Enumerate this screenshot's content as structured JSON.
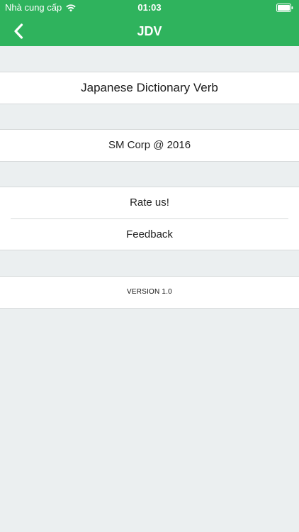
{
  "status_bar": {
    "carrier": "Nhà cung cấp",
    "time": "01:03",
    "icons": [
      "wifi-icon",
      "battery-icon"
    ]
  },
  "nav": {
    "title": "JDV",
    "back_icon": "chevron-left-icon",
    "background_color": "#2fb35d"
  },
  "content": {
    "app_name": "Japanese Dictionary Verb",
    "company": "SM Corp @ 2016",
    "actions": {
      "rate": "Rate us!",
      "feedback": "Feedback"
    },
    "version": "VERSION 1.0"
  },
  "colors": {
    "page_background": "#ebeff0",
    "cell_background": "#ffffff"
  }
}
